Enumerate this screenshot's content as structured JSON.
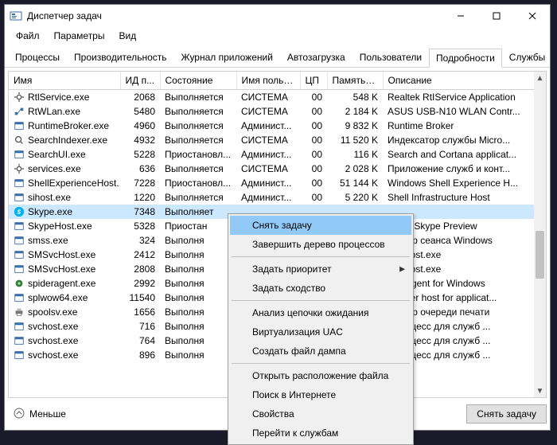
{
  "window": {
    "title": "Диспетчер задач"
  },
  "menubar": [
    "Файл",
    "Параметры",
    "Вид"
  ],
  "tabs": {
    "items": [
      "Процессы",
      "Производительность",
      "Журнал приложений",
      "Автозагрузка",
      "Пользователи",
      "Подробности",
      "Службы"
    ],
    "active_index": 5
  },
  "columns": [
    "Имя",
    "ИД п...",
    "Состояние",
    "Имя польз...",
    "ЦП",
    "Память (ч...",
    "Описание"
  ],
  "rows": [
    {
      "name": "RtlService.exe",
      "pid": "2068",
      "status": "Выполняется",
      "user": "СИСТЕМА",
      "cpu": "00",
      "mem": "548 K",
      "desc": "Realtek RtIService Application",
      "icon": "gear"
    },
    {
      "name": "RtWLan.exe",
      "pid": "5480",
      "status": "Выполняется",
      "user": "СИСТЕМА",
      "cpu": "00",
      "mem": "2 184 K",
      "desc": "ASUS USB-N10 WLAN Contr...",
      "icon": "net"
    },
    {
      "name": "RuntimeBroker.exe",
      "pid": "4960",
      "status": "Выполняется",
      "user": "Админист...",
      "cpu": "00",
      "mem": "9 832 K",
      "desc": "Runtime Broker",
      "icon": "window"
    },
    {
      "name": "SearchIndexer.exe",
      "pid": "4932",
      "status": "Выполняется",
      "user": "СИСТЕМА",
      "cpu": "00",
      "mem": "11 520 K",
      "desc": "Индексатор службы Micro...",
      "icon": "search"
    },
    {
      "name": "SearchUI.exe",
      "pid": "5228",
      "status": "Приостановл...",
      "user": "Админист...",
      "cpu": "00",
      "mem": "116 K",
      "desc": "Search and Cortana applicat...",
      "icon": "window"
    },
    {
      "name": "services.exe",
      "pid": "636",
      "status": "Выполняется",
      "user": "СИСТЕМА",
      "cpu": "00",
      "mem": "2 028 K",
      "desc": "Приложение служб и конт...",
      "icon": "gear"
    },
    {
      "name": "ShellExperienceHost...",
      "pid": "7228",
      "status": "Приостановл...",
      "user": "Админист...",
      "cpu": "00",
      "mem": "51 144 K",
      "desc": "Windows Shell Experience H...",
      "icon": "window"
    },
    {
      "name": "sihost.exe",
      "pid": "1220",
      "status": "Выполняется",
      "user": "Админист...",
      "cpu": "00",
      "mem": "5 220 K",
      "desc": "Shell Infrastructure Host",
      "icon": "window"
    },
    {
      "name": "Skype.exe",
      "pid": "7348",
      "status": "Выполняет",
      "user": "",
      "cpu": "",
      "mem": "",
      "desc": "",
      "icon": "skype",
      "selected": true
    },
    {
      "name": "SkypeHost.exe",
      "pid": "5328",
      "status": "Приостан",
      "user": "",
      "cpu": "",
      "mem": "",
      "desc": "rosoft Skype Preview",
      "icon": "window"
    },
    {
      "name": "smss.exe",
      "pid": "324",
      "status": "Выполня",
      "user": "",
      "cpu": "",
      "mem": "",
      "desc": "петчер сеанса  Windows",
      "icon": "window"
    },
    {
      "name": "SMSvcHost.exe",
      "pid": "2412",
      "status": "Выполня",
      "user": "",
      "cpu": "",
      "mem": "",
      "desc": "SvcHost.exe",
      "icon": "window"
    },
    {
      "name": "SMSvcHost.exe",
      "pid": "2808",
      "status": "Выполня",
      "user": "",
      "cpu": "",
      "mem": "",
      "desc": "SvcHost.exe",
      "icon": "window"
    },
    {
      "name": "spideragent.exe",
      "pid": "2992",
      "status": "Выполня",
      "user": "",
      "cpu": "",
      "mem": "",
      "desc": "Der Agent for Windows",
      "icon": "spider"
    },
    {
      "name": "splwow64.exe",
      "pid": "11540",
      "status": "Выполня",
      "user": "",
      "cpu": "",
      "mem": "",
      "desc": "it driver host for applicat...",
      "icon": "window"
    },
    {
      "name": "spoolsv.exe",
      "pid": "1656",
      "status": "Выполня",
      "user": "",
      "cpu": "",
      "mem": "",
      "desc": "петчер очереди печати",
      "icon": "printer"
    },
    {
      "name": "svchost.exe",
      "pid": "716",
      "status": "Выполня",
      "user": "",
      "cpu": "",
      "mem": "",
      "desc": "т-процесс для служб ...",
      "icon": "window"
    },
    {
      "name": "svchost.exe",
      "pid": "764",
      "status": "Выполня",
      "user": "",
      "cpu": "",
      "mem": "",
      "desc": "т-процесс для служб ...",
      "icon": "window"
    },
    {
      "name": "svchost.exe",
      "pid": "896",
      "status": "Выполня",
      "user": "",
      "cpu": "",
      "mem": "",
      "desc": "т-процесс для служб ...",
      "icon": "window"
    }
  ],
  "context_menu": [
    {
      "label": "Снять задачу",
      "hl": true
    },
    {
      "label": "Завершить дерево процессов"
    },
    {
      "sep": true
    },
    {
      "label": "Задать приоритет",
      "submenu": true
    },
    {
      "label": "Задать сходство"
    },
    {
      "sep": true
    },
    {
      "label": "Анализ цепочки ожидания"
    },
    {
      "label": "Виртуализация UAC"
    },
    {
      "label": "Создать файл дампа"
    },
    {
      "sep": true
    },
    {
      "label": "Открыть расположение файла"
    },
    {
      "label": "Поиск в Интернете"
    },
    {
      "label": "Свойства"
    },
    {
      "label": "Перейти к службам"
    }
  ],
  "footer": {
    "fewer": "Меньше",
    "end_task": "Снять задачу"
  }
}
